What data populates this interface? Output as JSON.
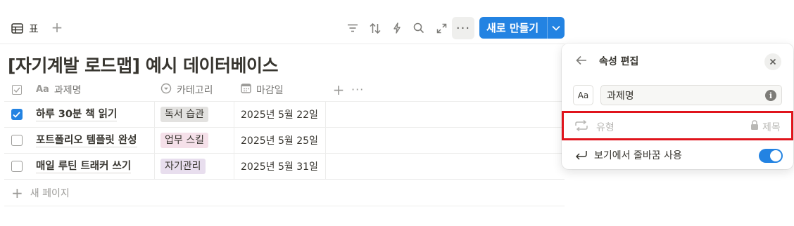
{
  "toolbar": {
    "view_tab_label": "표",
    "add_view_glyph": "+",
    "more_glyph": "···",
    "new_button_label": "새로 만들기",
    "tools": [
      "filter-icon",
      "sort-icon",
      "automation-icon",
      "search-icon",
      "expand-icon"
    ]
  },
  "database": {
    "title": "[자기계발 로드맵] 예시 데이터베이스",
    "columns": {
      "check": "checkbox",
      "name_prefix": "Aa",
      "name": "과제명",
      "category": "카테고리",
      "due_date": "마감일",
      "add_glyph": "+",
      "more_glyph": "···"
    },
    "rows": [
      {
        "checked": true,
        "name": "하루 30분 책 읽기",
        "category": "독서 습관",
        "category_bg": "#e3e2e0",
        "date": "2025년 5월 22일"
      },
      {
        "checked": false,
        "name": "포트폴리오 템플릿 완성",
        "category": "업무 스킬",
        "category_bg": "#f5e0e9",
        "date": "2025년 5월 25일"
      },
      {
        "checked": false,
        "name": "매일 루틴 트래커 쓰기",
        "category": "자기관리",
        "category_bg": "#e8deee",
        "date": "2025년 5월 31일"
      }
    ],
    "new_page_label": "새 페이지"
  },
  "panel": {
    "title": "속성 편집",
    "type_box_label": "Aa",
    "property_name": "과제명",
    "type_label": "유형",
    "locked_label": "제목",
    "wrap_label": "보기에서 줄바꿈 사용",
    "wrap_enabled": true,
    "highlight_color": "#e0141c"
  },
  "colors": {
    "accent": "#2383e2",
    "text": "#37352f",
    "muted": "#787774"
  }
}
